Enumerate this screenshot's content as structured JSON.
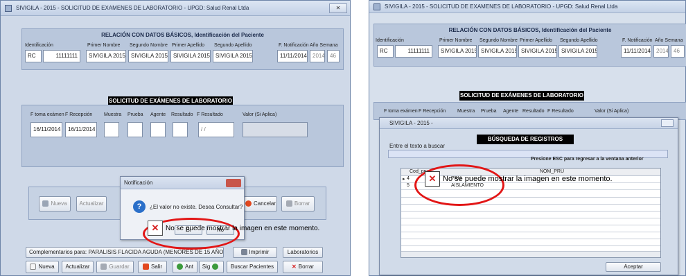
{
  "left": {
    "title": "SIVIGILA - 2015 - SOLICITUD DE EXAMENES DE LABORATORIO - UPGD: Salud Renal Ltda",
    "close_label": "✕",
    "section1_header": "RELACIÓN CON DATOS BÁSICOS, Identificación del Paciente",
    "labels": {
      "identificacion": "Identificación",
      "primer_nombre": "Primer Nombre",
      "segundo_nombre": "Segundo Nombre",
      "primer_apellido": "Primer Apellido",
      "segundo_apellido": "Segundo Apellido",
      "f_notificacion": "F. Notificación",
      "anio_semana": "Año Semana"
    },
    "values": {
      "tipo": "RC",
      "id": "11111111",
      "primer_nombre": "SIVIGILA 2015",
      "segundo_nombre": "SIVIGILA 2015",
      "primer_apellido": "SIVIGILA 2015",
      "segundo_apellido": "SIVIGILA 2015",
      "f_notificacion": "11/11/2014",
      "anio": "2014",
      "semana": "46"
    },
    "section2_header": "SOLICITUD DE EXÁMENES DE LABORATORIO",
    "lab_labels": {
      "f_toma": "F toma exámen",
      "f_recepcion": "F Recepción",
      "muestra": "Muestra",
      "prueba": "Prueba",
      "agente": "Agente",
      "resultado": "Resultado",
      "f_resultado": "F Resultado",
      "valor": "Valor (Si Aplica)"
    },
    "lab_values": {
      "f_toma": "16/11/2014",
      "f_recepcion": "16/11/2014",
      "f_resultado": "/ /"
    },
    "inner_buttons": {
      "nueva": "Nueva",
      "actualizar": "Actualizar",
      "cancelar": "Cancelar",
      "borrar": "Borrar"
    },
    "complementarios": "Complementarios para: PARALISIS FLACIDA AGUDA (MENORES DE 15 AÑOS)",
    "imprimir": "Imprimir",
    "laboratorios": "Laboratorios",
    "bottom_buttons": {
      "nueva": "Nueva",
      "actualizar": "Actualizar",
      "guardar": "Guardar",
      "salir": "Salir",
      "ant": "Ant",
      "sig": "Sig",
      "buscar": "Buscar Pacientes",
      "borrar": "Borrar"
    },
    "notificacion": {
      "title": "Notificación",
      "message": "¿El valor no existe. Desea Consultar?",
      "si": "Si",
      "no": "No"
    },
    "image_error": "No se puede mostrar la imagen en este momento."
  },
  "right": {
    "title": "SIVIGILA - 2015 - SOLICITUD DE EXAMENES DE LABORATORIO - UPGD: Salud Renal Ltda",
    "section1_header": "RELACIÓN CON DATOS BÁSICOS, Identificación del Paciente",
    "labels": {
      "identificacion": "Identificación",
      "primer_nombre": "Primer Nombre",
      "segundo_nombre": "Segundo Nombre",
      "primer_apellido": "Primer Apellido",
      "segundo_apellido": "Segundo Apellido",
      "f_notificacion": "F. Notificación",
      "anio_semana": "Año Semana"
    },
    "values": {
      "tipo": "RC",
      "id": "11111111",
      "primer_nombre": "SIVIGILA 2015",
      "segundo_nombre": "SIVIGILA 2015",
      "primer_apellido": "SIVIGILA 2015",
      "segundo_apellido": "SIVIGILA 2015",
      "f_notificacion": "11/11/2014",
      "anio": "2014",
      "semana": "46"
    },
    "section2_header": "SOLICITUD DE EXÁMENES DE LABORATORIO",
    "lab_labels": {
      "f_toma": "F toma exámen",
      "f_recepcion": "F Recepción",
      "muestra": "Muestra",
      "prueba": "Prueba",
      "agente": "Agente",
      "resultado": "Resultado",
      "f_resultado": "F Resultado",
      "valor": "Valor (Si Aplica)"
    },
    "search": {
      "title": "SIVIGILA - 2015 -",
      "header": "BÚSQUEDA DE REGISTROS",
      "prompt": "Entre el texto a buscar",
      "esc_hint": "Presione ESC para regresar a la ventana anterior",
      "columns": {
        "cod": "Cod_pru",
        "nom": "NOM_PRU"
      },
      "rows": [
        {
          "cod": "4",
          "nom": "PRU"
        },
        {
          "cod": "5",
          "nom": "AISLAMIENTO"
        }
      ],
      "aceptar": "Aceptar"
    },
    "image_error": "No se puede mostrar la imagen en este momento."
  },
  "colors": {
    "accent_ring": "#e21616",
    "error_x": "#d61f1f",
    "header_bar": "#5a6f95"
  }
}
